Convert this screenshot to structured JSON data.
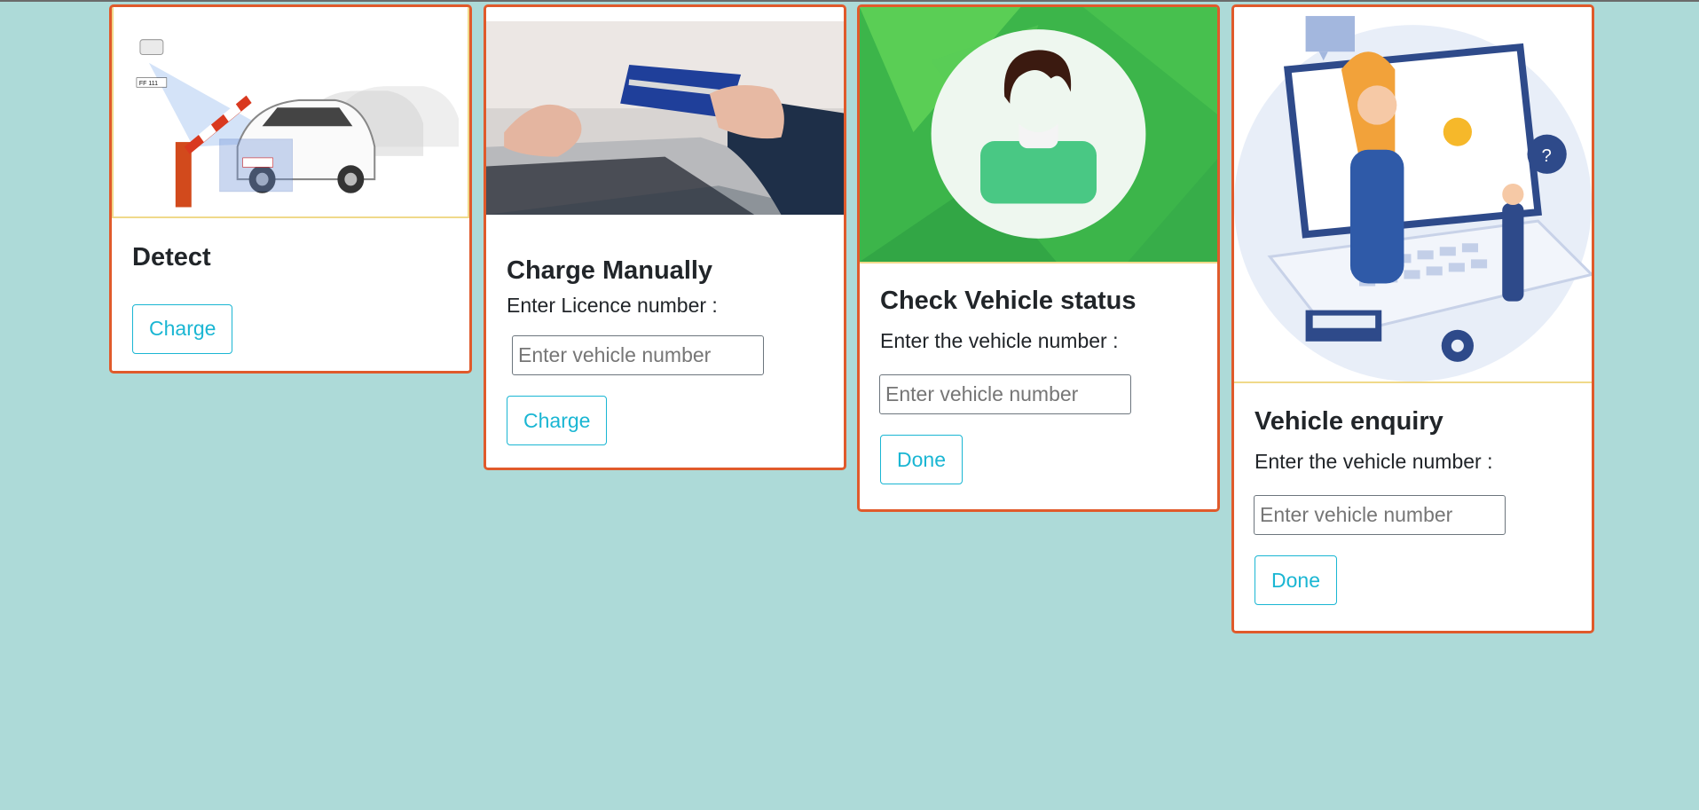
{
  "cards": [
    {
      "title": "Detect",
      "image_icon": "car-barrier-camera-illustration",
      "plate_text": "FF 111",
      "button_label": "Charge"
    },
    {
      "title": "Charge Manually",
      "image_icon": "credit-card-laptop-photo",
      "prompt": "Enter Licence number :",
      "input_placeholder": "Enter vehicle number",
      "button_label": "Charge"
    },
    {
      "title": "Check Vehicle status",
      "image_icon": "user-avatar-icon",
      "prompt": "Enter the vehicle number :",
      "input_placeholder": "Enter vehicle number",
      "button_label": "Done"
    },
    {
      "title": "Vehicle enquiry",
      "image_icon": "support-laptop-illustration",
      "prompt": "Enter the vehicle number :",
      "input_placeholder": "Enter vehicle number",
      "button_label": "Done"
    }
  ],
  "colors": {
    "background": "#addad8",
    "card_border": "#e05a2b",
    "button_accent": "#1ab6d3",
    "avatar_green": "#3cb54a"
  }
}
